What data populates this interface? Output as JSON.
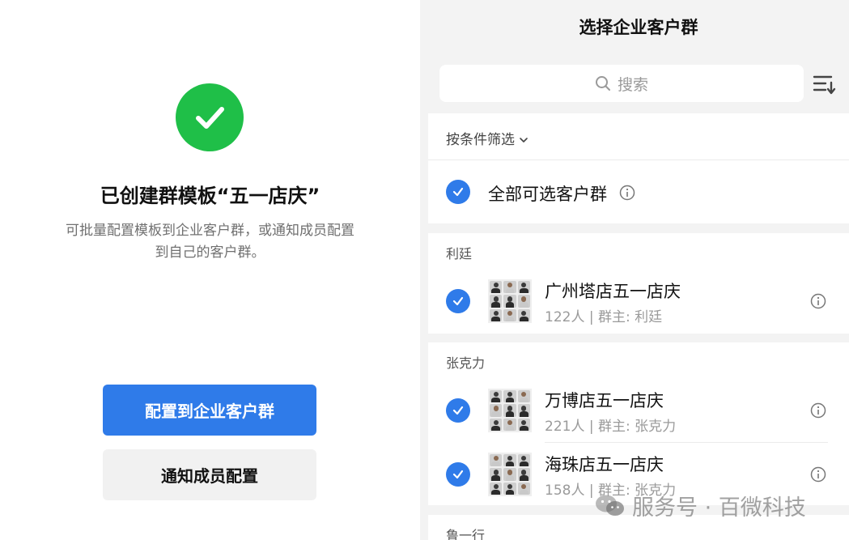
{
  "left": {
    "title": "已创建群模板“五一店庆”",
    "desc_line1": "可批量配置模板到企业客户群，或通知成员配置",
    "desc_line2": "到自己的客户群。",
    "primary_button": "配置到企业客户群",
    "secondary_button": "通知成员配置"
  },
  "right": {
    "title": "选择企业客户群",
    "search_placeholder": "搜索",
    "filter_label": "按条件筛选",
    "select_all_label": "全部可选客户群",
    "groups": [
      {
        "owner": "利廷",
        "items": [
          {
            "name": "广州塔店五一店庆",
            "meta": "122人 | 群主: 利廷"
          }
        ]
      },
      {
        "owner": "张克力",
        "items": [
          {
            "name": "万博店五一店庆",
            "meta": "221人 | 群主: 张克力"
          },
          {
            "name": "海珠店五一店庆",
            "meta": "158人 | 群主: 张克力"
          }
        ]
      },
      {
        "owner": "鲁一行",
        "items": []
      }
    ]
  },
  "watermark": "服务号 · 百微科技",
  "colors": {
    "accent": "#2f7be9",
    "success": "#1fbf48"
  }
}
